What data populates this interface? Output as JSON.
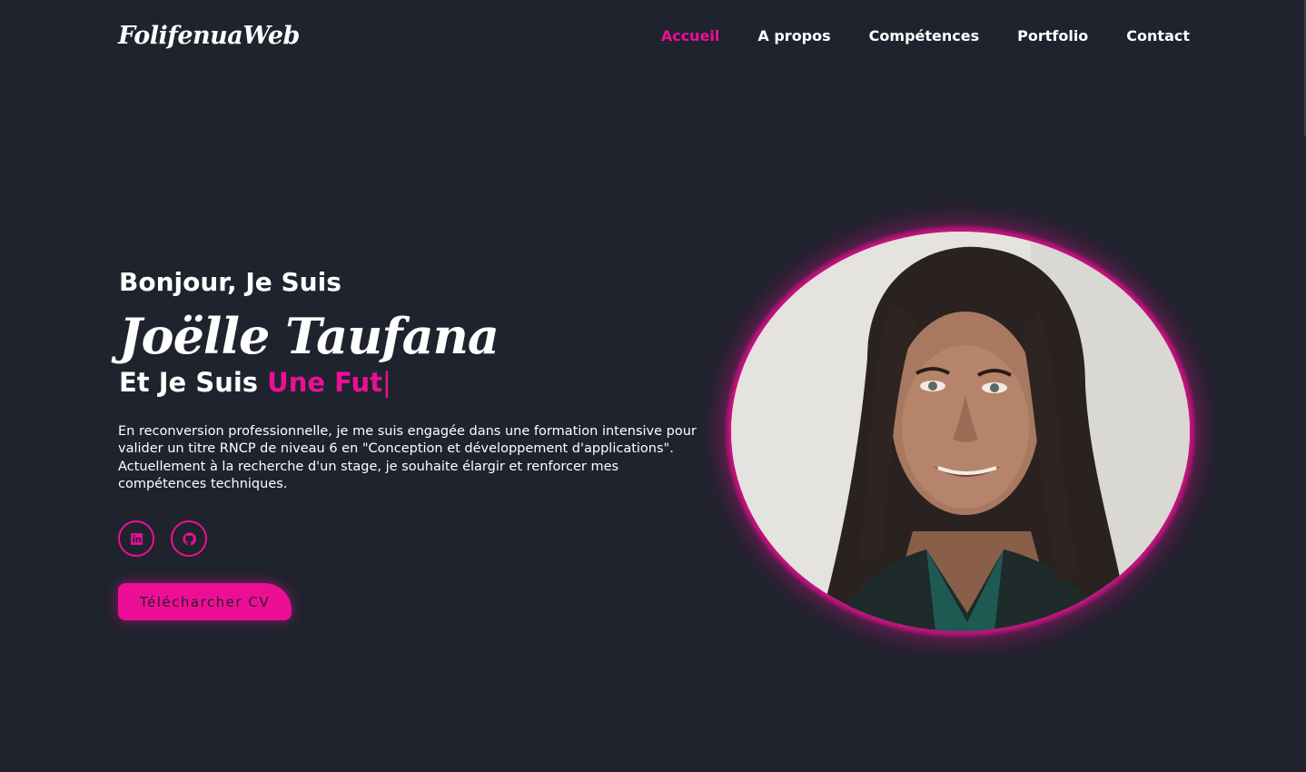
{
  "brand": {
    "logo": "FolifenuaWeb"
  },
  "nav": {
    "items": [
      {
        "label": "Accueil",
        "active": true
      },
      {
        "label": "A propos",
        "active": false
      },
      {
        "label": "Compétences",
        "active": false
      },
      {
        "label": "Portfolio",
        "active": false
      },
      {
        "label": "Contact",
        "active": false
      }
    ]
  },
  "hero": {
    "greeting": "Bonjour, Je Suis",
    "name": "Joëlle Taufana",
    "role_prefix": "Et Je Suis",
    "role_typed": "Une Fut",
    "caret": "|",
    "intro": "En reconversion professionnelle, je me suis engagée dans une formation intensive pour valider un titre RNCP de niveau 6 en \"Conception et développement d'applications\". Actuellement à la recherche d'un stage, je souhaite élargir et renforcer mes compétences techniques.",
    "cv_button": "Télécharcher CV",
    "socials": [
      {
        "icon": "linkedin-icon"
      },
      {
        "icon": "github-icon"
      }
    ]
  },
  "colors": {
    "background": "#1f232d",
    "accent": "#ec0f96",
    "text": "#ffffff"
  }
}
